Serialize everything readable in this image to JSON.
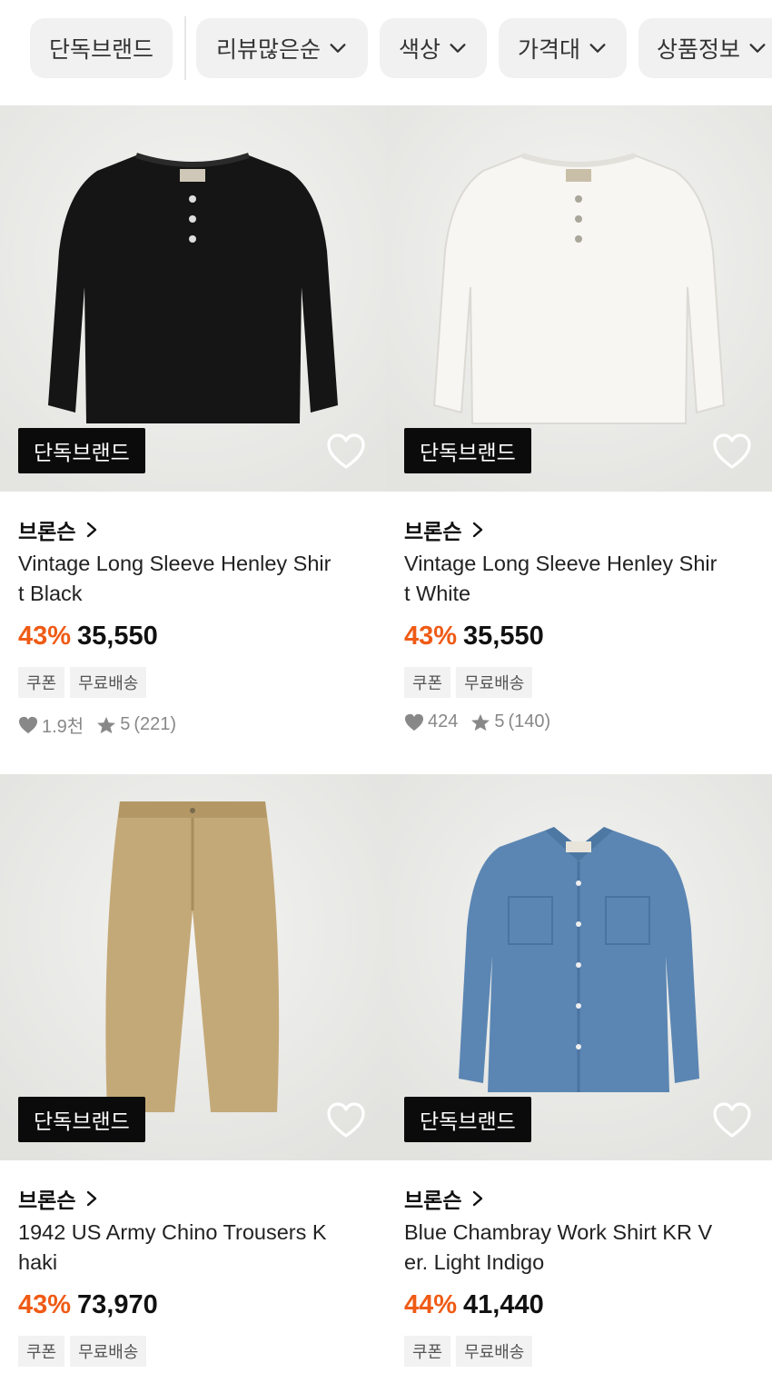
{
  "filters": {
    "exclusive": "단독브랜드",
    "sort": "리뷰많은순",
    "color": "색상",
    "price": "가격대",
    "info": "상품정보"
  },
  "products": [
    {
      "badge": "단독브랜드",
      "brand": "브론슨",
      "title": "Vintage Long Sleeve Henley Shirt Black",
      "discount": "43%",
      "price": "35,550",
      "tags": [
        "쿠폰",
        "무료배송"
      ],
      "likes": "1.9천",
      "rating": "5",
      "reviews": "(221)",
      "image": "black henley shirt"
    },
    {
      "badge": "단독브랜드",
      "brand": "브론슨",
      "title": "Vintage Long Sleeve Henley Shirt White",
      "discount": "43%",
      "price": "35,550",
      "tags": [
        "쿠폰",
        "무료배송"
      ],
      "likes": "424",
      "rating": "5",
      "reviews": "(140)",
      "image": "white henley shirt"
    },
    {
      "badge": "단독브랜드",
      "brand": "브론슨",
      "title": "1942 US Army Chino Trousers Khaki",
      "discount": "43%",
      "price": "73,970",
      "tags": [
        "쿠폰",
        "무료배송"
      ],
      "image": "khaki chino trousers"
    },
    {
      "badge": "단독브랜드",
      "brand": "브론슨",
      "title": "Blue Chambray Work Shirt KR Ver. Light Indigo",
      "discount": "44%",
      "price": "41,440",
      "tags": [
        "쿠폰",
        "무료배송"
      ],
      "image": "blue chambray shirt"
    }
  ],
  "colors": {
    "discount": "#ef5b16",
    "badge_bg": "#0b0b0b",
    "chip_bg": "#f1f1f1",
    "image_bg": "#eeeeec"
  }
}
